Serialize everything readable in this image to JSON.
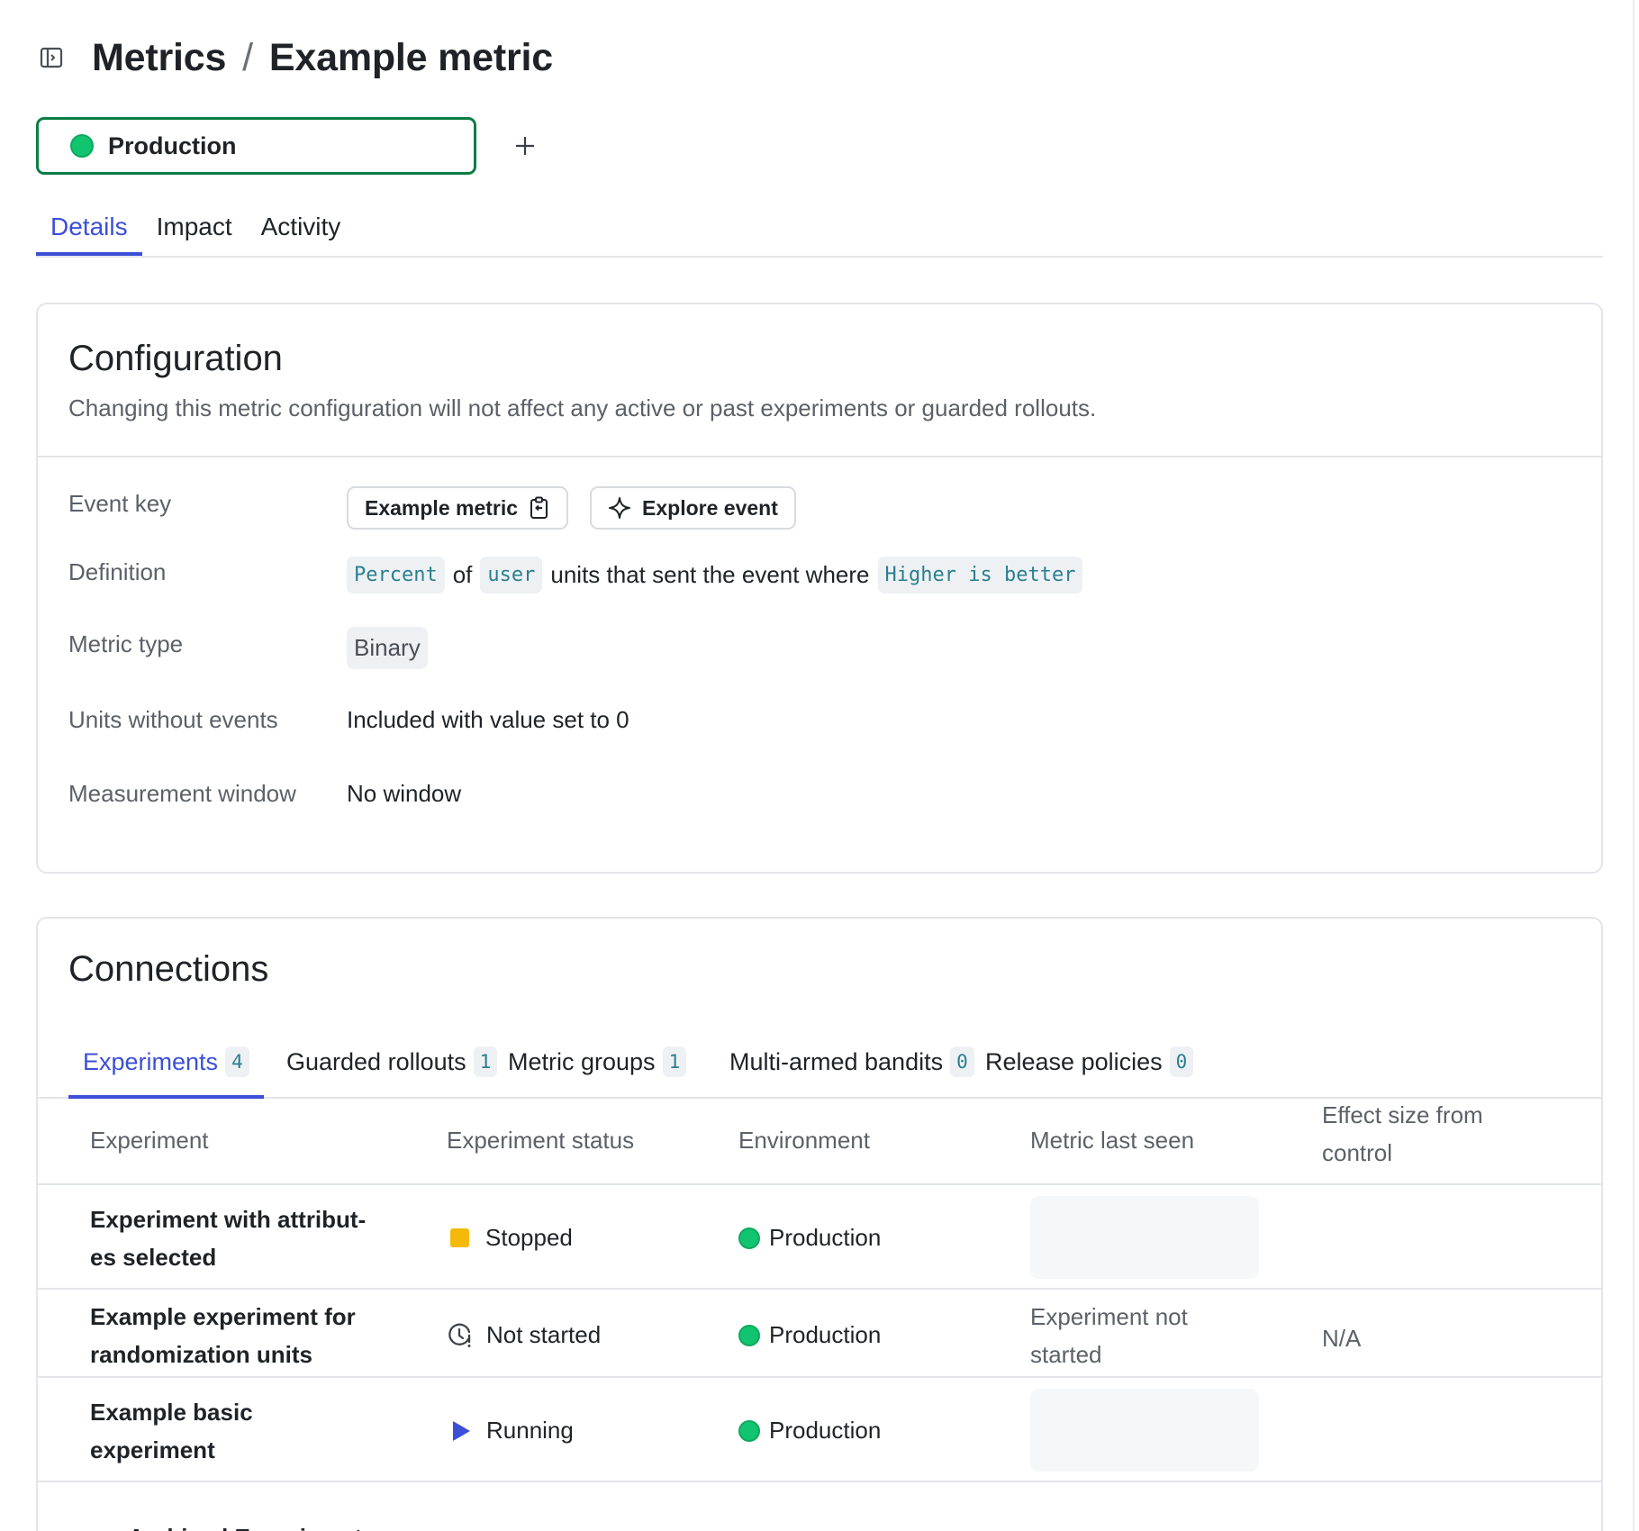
{
  "header": {
    "breadcrumb_parent": "Metrics",
    "separator": "/",
    "title": "Example metric",
    "sidebar_toggle_icon": "sidebar-panel-icon"
  },
  "environment": {
    "name": "Production",
    "status_color": "#11c46f",
    "add_icon": "plus-icon"
  },
  "tabs": [
    {
      "label": "Details",
      "active": true
    },
    {
      "label": "Impact",
      "active": false
    },
    {
      "label": "Activity",
      "active": false
    }
  ],
  "configuration": {
    "title": "Configuration",
    "subtitle": "Changing this metric configuration will not affect any active or past experiments or guarded rollouts.",
    "event_key": {
      "label": "Event key",
      "value_button": "Example metric",
      "copy_icon": "clipboard-copy-icon",
      "explore_button": "Explore event",
      "explore_icon": "sparkle-icon"
    },
    "definition": {
      "label": "Definition",
      "aggregation": "Percent",
      "of_text": "of",
      "unit": "user",
      "middle_text": "units that sent the event where",
      "direction": "Higher is better"
    },
    "metric_type": {
      "label": "Metric type",
      "value": "Binary"
    },
    "units_without_events": {
      "label": "Units without events",
      "value": "Included with value set to 0"
    },
    "measurement_window": {
      "label": "Measurement window",
      "value": "No window"
    }
  },
  "connections": {
    "title": "Connections",
    "tabs": [
      {
        "label": "Experiments",
        "count": "4",
        "active": true
      },
      {
        "label": "Guarded rollouts",
        "count": "1",
        "active": false
      },
      {
        "label": "Metric groups",
        "count": "1",
        "active": false
      },
      {
        "label": "Multi-armed bandits",
        "count": "0",
        "active": false
      },
      {
        "label": "Release policies",
        "count": "0",
        "active": false
      }
    ],
    "columns": {
      "experiment": "Experiment",
      "status": "Experiment status",
      "environment": "Environment",
      "last_seen": "Metric last seen",
      "effect_line1": "Effect size from",
      "effect_line2": "control"
    },
    "rows": [
      {
        "name_line1": "Experiment with attribut-",
        "name_line2": "es selected",
        "status": "Stopped",
        "status_icon": "stopped-square-icon",
        "status_color": "#f5b90a",
        "environment": "Production",
        "last_seen_line1": "",
        "last_seen_line2": "",
        "effect": ""
      },
      {
        "name_line1": "Example experiment for",
        "name_line2": "randomization units",
        "status": "Not started",
        "status_icon": "clock-alert-icon",
        "environment": "Production",
        "last_seen_line1": "Experiment not",
        "last_seen_line2": "started",
        "effect": "N/A"
      },
      {
        "name_line1": "Example basic",
        "name_line2": "experiment",
        "status": "Running",
        "status_icon": "play-icon",
        "status_color": "#3b4fd8",
        "environment": "Production",
        "last_seen_line1": "",
        "last_seen_line2": "",
        "effect": ""
      }
    ],
    "archived_label": "Archived Experiments",
    "archived_icon": "chevron-down-icon"
  }
}
